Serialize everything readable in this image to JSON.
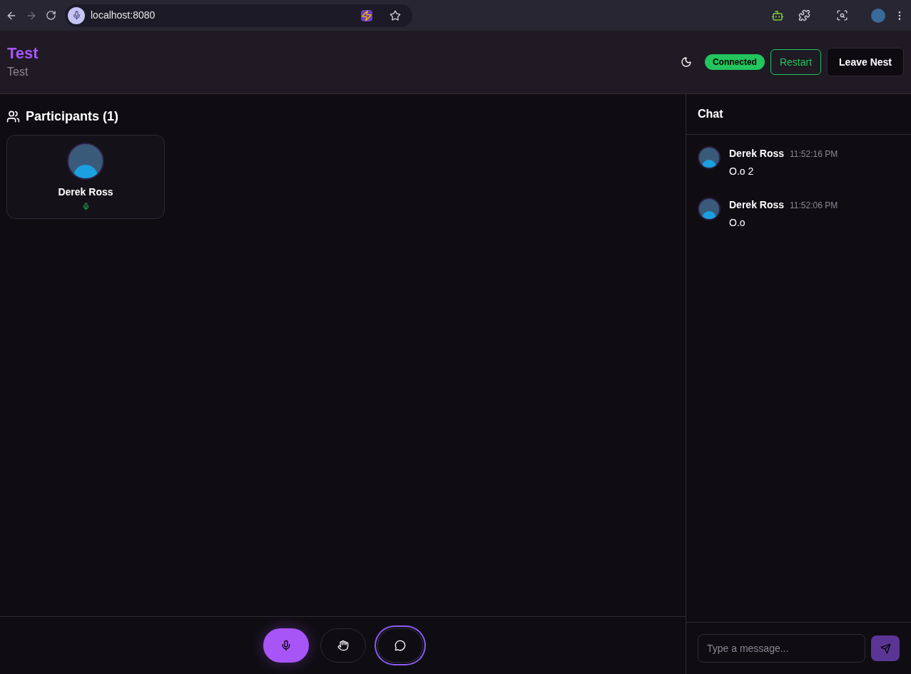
{
  "browser": {
    "url": "localhost:8080"
  },
  "header": {
    "title": "Test",
    "subtitle": "Test",
    "status": {
      "label": "Connected",
      "color": "#22c55e"
    },
    "buttons": [
      {
        "label": "Restart",
        "kind": "outline"
      },
      {
        "label": "Leave Nest",
        "kind": "dark"
      }
    ]
  },
  "participants": {
    "title": "Participants (1)",
    "items": [
      {
        "name": "Derek Ross",
        "muted": false
      }
    ]
  },
  "controls": [
    {
      "kind": "mic",
      "active": true
    },
    {
      "kind": "hand",
      "active": false
    },
    {
      "kind": "chat",
      "active": true
    }
  ],
  "chat": {
    "title": "Chat",
    "messages": [
      {
        "author": "Derek Ross",
        "time": "11:52:16 PM",
        "text": "O.o 2"
      },
      {
        "author": "Derek Ross",
        "time": "11:52:06 PM",
        "text": "O.o"
      }
    ],
    "input": {
      "placeholder": "Type a message..."
    }
  }
}
